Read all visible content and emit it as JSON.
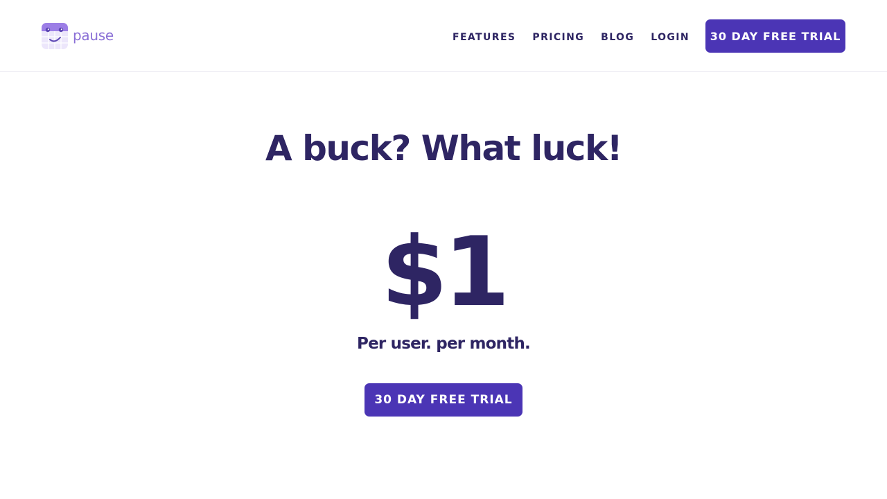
{
  "brand": {
    "name": "pause",
    "logo_icon": "calendar-face-icon",
    "color": "#8a6fd6"
  },
  "nav": {
    "items": [
      {
        "label": "FEATURES"
      },
      {
        "label": "PRICING"
      },
      {
        "label": "BLOG"
      },
      {
        "label": "LOGIN"
      }
    ],
    "cta_label": "30 DAY FREE TRIAL"
  },
  "hero": {
    "title": "A buck? What luck!",
    "price": "$1",
    "price_caption": "Per user. per month.",
    "cta_label": "30 DAY FREE TRIAL"
  },
  "colors": {
    "primary": "#4b35b5",
    "heading": "#2e2563",
    "background": "#ffffff"
  }
}
